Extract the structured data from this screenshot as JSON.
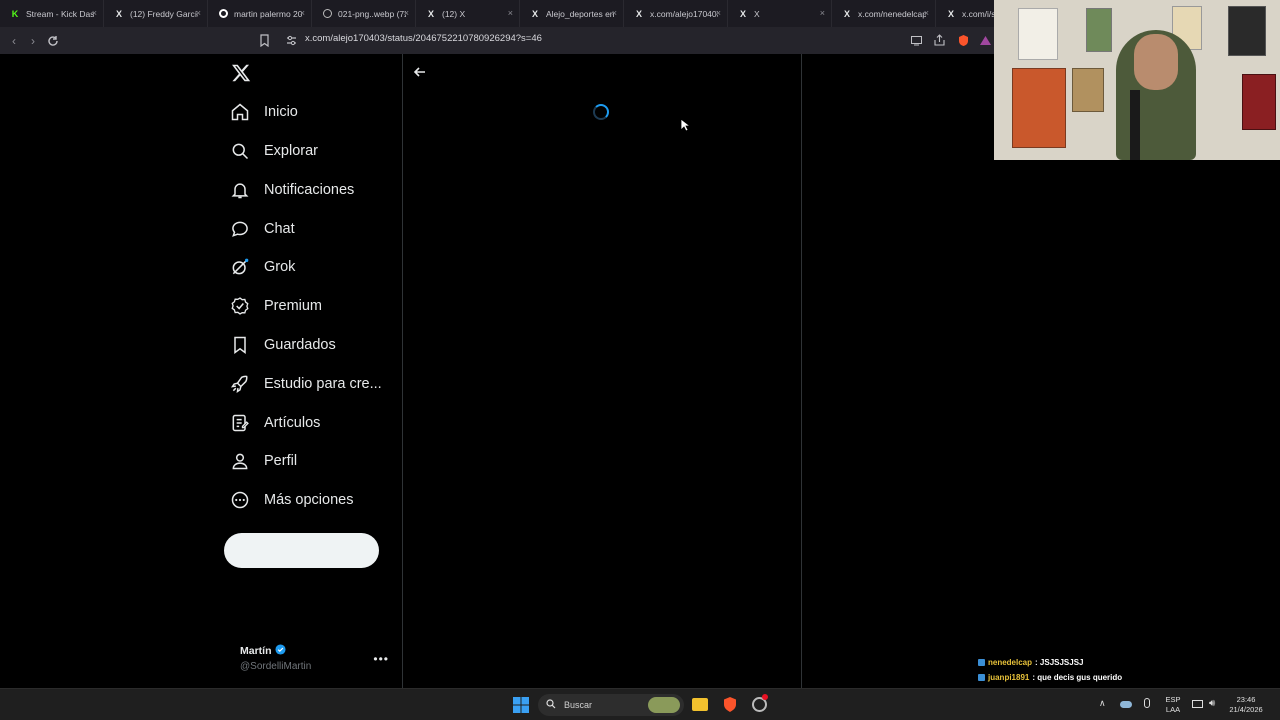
{
  "browser": {
    "tabs": [
      {
        "title": "Stream - Kick Dashb",
        "icon": "kick-icon"
      },
      {
        "title": "(12) Freddy García",
        "icon": "x-logo-icon"
      },
      {
        "title": "martin palermo 202",
        "icon": "google-icon"
      },
      {
        "title": "021-png..webp (72",
        "icon": "globe-icon"
      },
      {
        "title": "(12) X",
        "icon": "x-logo-icon"
      },
      {
        "title": "Alejo_deportes en X",
        "icon": "x-logo-icon"
      },
      {
        "title": "x.com/alejo170403/",
        "icon": "x-logo-icon"
      },
      {
        "title": "X",
        "icon": "x-logo-icon"
      },
      {
        "title": "x.com/nenedelcap/",
        "icon": "x-logo-icon"
      },
      {
        "title": "x.com/i/sta",
        "icon": "x-logo-icon"
      }
    ],
    "url": "x.com/alejo170403/status/2046752210780926294?s=46"
  },
  "sidebar": {
    "items": [
      {
        "label": "Inicio",
        "icon": "home-icon"
      },
      {
        "label": "Explorar",
        "icon": "search-icon"
      },
      {
        "label": "Notificaciones",
        "icon": "bell-icon"
      },
      {
        "label": "Chat",
        "icon": "chat-bubble-icon"
      },
      {
        "label": "Grok",
        "icon": "grok-icon"
      },
      {
        "label": "Premium",
        "icon": "verified-badge-icon"
      },
      {
        "label": "Guardados",
        "icon": "bookmark-icon"
      },
      {
        "label": "Estudio para cre...",
        "icon": "rocket-icon"
      },
      {
        "label": "Artículos",
        "icon": "article-icon"
      },
      {
        "label": "Perfil",
        "icon": "person-icon"
      },
      {
        "label": "Más opciones",
        "icon": "more-circle-icon"
      }
    ],
    "account": {
      "name": "Martín",
      "handle": "@SordelliMartin"
    }
  },
  "stream_chat": [
    {
      "user": "nenedelcap",
      "message": ": JSJSJSJSJ"
    },
    {
      "user": "juanpi1891",
      "message": ": que decis gus querido"
    }
  ],
  "taskbar": {
    "search_placeholder": "Buscar",
    "language": "ESP",
    "layout": "LAA",
    "time": "23:46",
    "date": "21/4/2026"
  },
  "colors": {
    "accent": "#1d9bf0",
    "background": "#000000",
    "text": "#e7e9ea"
  }
}
